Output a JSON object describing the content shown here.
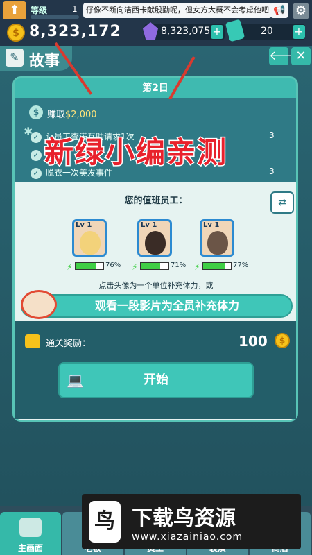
{
  "hud": {
    "level_label": "等级",
    "level_value": "1",
    "ticker_text": "仔像不断向洁西卡献殷勤呢，但女方大概不会考虑他吧",
    "gold_amount": "8,323,172",
    "gem_amount": "8,323,075",
    "ticket_amount": "20"
  },
  "panel": {
    "title": "故事",
    "day_header": "第2日",
    "earn_prefix": "赚取",
    "earn_amount": "$2,000",
    "tasks": [
      {
        "text": "让员工查满互助请求1次",
        "count": "3"
      },
      {
        "text": "",
        "count": ""
      },
      {
        "text": "脱衣一次美发事件",
        "count": "3"
      }
    ],
    "watermark_overlay": "新绿小编亲测",
    "staff_title": "您的值班员工：",
    "staff": [
      {
        "level": "Lv 1",
        "stamina_pct": 76,
        "stamina_label": "76%"
      },
      {
        "level": "Lv 1",
        "stamina_pct": 71,
        "stamina_label": "71%"
      },
      {
        "level": "Lv 1",
        "stamina_pct": 77,
        "stamina_label": "77%"
      }
    ],
    "tap_hint": "点击头像为一个单位补充体力，或",
    "ad_button_label": "观看一段影片为全员补充体力",
    "reward_label": "通关奖励：",
    "reward_amount": "100",
    "start_label": "开始"
  },
  "nav": {
    "tabs": [
      {
        "label": "主画面",
        "active": true
      },
      {
        "label": "老板",
        "active": false
      },
      {
        "label": "员工",
        "active": false
      },
      {
        "label": "装潢",
        "active": false
      },
      {
        "label": "商店",
        "active": false
      }
    ]
  },
  "watermark": {
    "brand": "下载鸟资源",
    "url": "www.xiazainiao.com"
  },
  "colors": {
    "accent": "#3fc6b8",
    "panel": "#2a6572",
    "card": "#e6f3f1",
    "gold": "#f6c21b",
    "stamina": "#3fcf45",
    "overlay_red": "#e8212c"
  }
}
